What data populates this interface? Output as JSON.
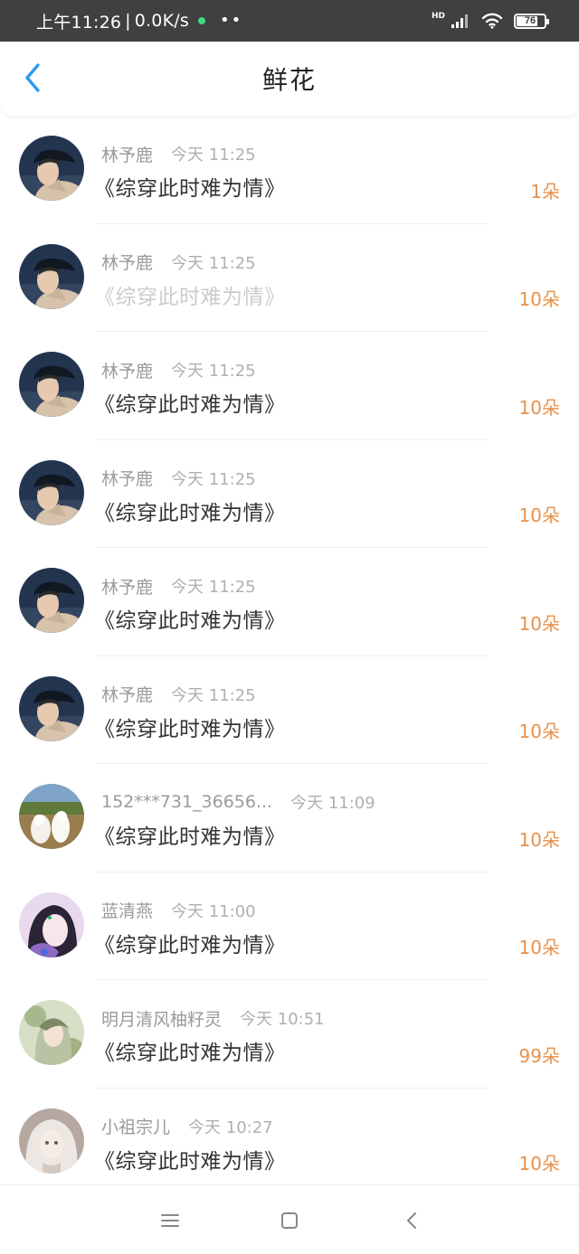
{
  "status_bar": {
    "time": "上午11:26",
    "network_speed": "0.0K/s",
    "separator": "|",
    "dots": "••",
    "signal_label": "HD",
    "battery": "76",
    "battery_level": 0.76,
    "icons": [
      "signal-icon",
      "wifi-icon",
      "battery-icon"
    ],
    "notification_color": "#3ddc84"
  },
  "header": {
    "title": "鲜花",
    "back_icon": "chevron-left-icon",
    "accent_color": "#2a9cf0"
  },
  "items": [
    {
      "user": "林予鹿",
      "time": "今天 11:25",
      "book": "《综穿此时难为情》",
      "count": "1朵",
      "faded": false,
      "avatar": "avatar-hat-man"
    },
    {
      "user": "林予鹿",
      "time": "今天 11:25",
      "book": "《综穿此时难为情》",
      "count": "10朵",
      "faded": true,
      "avatar": "avatar-hat-man"
    },
    {
      "user": "林予鹿",
      "time": "今天 11:25",
      "book": "《综穿此时难为情》",
      "count": "10朵",
      "faded": false,
      "avatar": "avatar-hat-man"
    },
    {
      "user": "林予鹿",
      "time": "今天 11:25",
      "book": "《综穿此时难为情》",
      "count": "10朵",
      "faded": false,
      "avatar": "avatar-hat-man"
    },
    {
      "user": "林予鹿",
      "time": "今天 11:25",
      "book": "《综穿此时难为情》",
      "count": "10朵",
      "faded": false,
      "avatar": "avatar-hat-man"
    },
    {
      "user": "林予鹿",
      "time": "今天 11:25",
      "book": "《综穿此时难为情》",
      "count": "10朵",
      "faded": false,
      "avatar": "avatar-hat-man"
    },
    {
      "user": "152***731_36656...",
      "time": "今天 11:09",
      "book": "《综穿此时难为情》",
      "count": "10朵",
      "faded": false,
      "avatar": "avatar-white-dogs"
    },
    {
      "user": "蓝清燕",
      "time": "今天 11:00",
      "book": "《综穿此时难为情》",
      "count": "10朵",
      "faded": false,
      "avatar": "avatar-purple-girl"
    },
    {
      "user": "明月清风柚籽灵",
      "time": "今天 10:51",
      "book": "《综穿此时难为情》",
      "count": "99朵",
      "faded": false,
      "avatar": "avatar-green-fairy"
    },
    {
      "user": "小祖宗儿",
      "time": "今天 10:27",
      "book": "《综穿此时难为情》",
      "count": "10朵",
      "faded": false,
      "avatar": "avatar-pale-girl"
    }
  ],
  "nav_bar": {
    "icons": [
      "menu-icon",
      "home-square-icon",
      "back-triangle-icon"
    ]
  },
  "colors": {
    "count_color": "#e8914a",
    "title_color": "#333333",
    "meta_color": "#9a9a9a",
    "faded_title_color": "#cccccc"
  }
}
